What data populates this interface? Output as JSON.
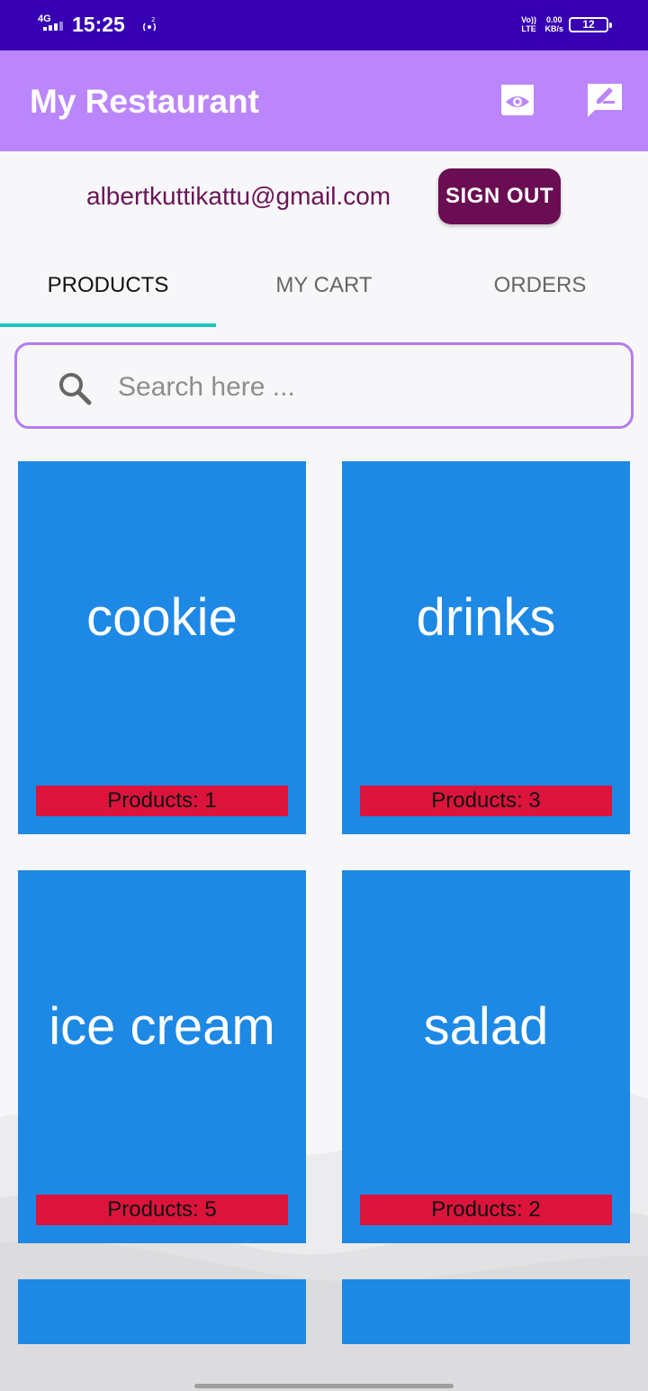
{
  "status_bar": {
    "network": "4G",
    "time": "15:25",
    "hotspot_count": "2",
    "volte": [
      "Vo))",
      "LTE"
    ],
    "speed": [
      "0.00",
      "KB/s"
    ],
    "battery": "12"
  },
  "app_bar": {
    "title": "My Restaurant",
    "icons": [
      "eye-icon",
      "feedback-icon"
    ],
    "color": "#bb86fc"
  },
  "user": {
    "email": "albertkuttikattu@gmail.com",
    "sign_out_label": "SIGN OUT"
  },
  "tabs": [
    {
      "label": "PRODUCTS",
      "active": true
    },
    {
      "label": "MY CART",
      "active": false
    },
    {
      "label": "ORDERS",
      "active": false
    }
  ],
  "search": {
    "placeholder": "Search here ..."
  },
  "categories": [
    {
      "name": "cookie",
      "count_label": "Products: 1"
    },
    {
      "name": "drinks",
      "count_label": "Products: 3"
    },
    {
      "name": "ice cream",
      "count_label": "Products: 5"
    },
    {
      "name": "salad",
      "count_label": "Products: 2"
    }
  ],
  "colors": {
    "status_bar": "#3700b3",
    "card": "#1e88e5",
    "badge": "#dc143c",
    "tab_indicator": "#20c5bd",
    "sign_out": "#6a0d52"
  }
}
